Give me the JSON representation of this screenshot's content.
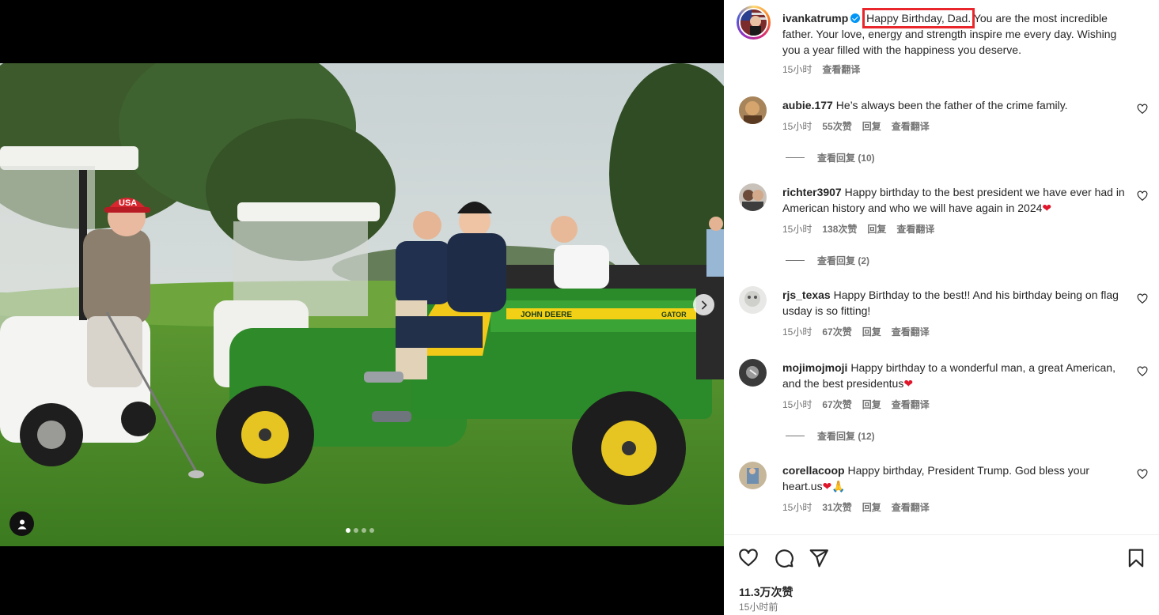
{
  "post": {
    "author": "ivankatrump",
    "caption_highlight": "Happy Birthday, Dad.",
    "caption_rest": " You are the most incredible father. Your love, energy and strength inspire me every day. Wishing you a year filled with the happiness you deserve.",
    "time": "15小时",
    "translate": "查看翻译"
  },
  "comments": [
    {
      "user": "aubie.177",
      "text": "He’s always been the father of the crime family.",
      "emoji": "",
      "time": "15小时",
      "likes": "55次赞",
      "reply": "回复",
      "translate": "查看翻译",
      "view_replies": "查看回复 (10)"
    },
    {
      "user": "richter3907",
      "text": "Happy birthday to the best president we have ever had in American history and who we will have again in 2024",
      "emoji": "❤",
      "time": "15小时",
      "likes": "138次赞",
      "reply": "回复",
      "translate": "查看翻译",
      "view_replies": "查看回复 (2)"
    },
    {
      "user": "rjs_texas",
      "text": "Happy Birthday to the best!! And his birthday being on flag usday is so fitting!",
      "emoji": "",
      "time": "15小时",
      "likes": "67次赞",
      "reply": "回复",
      "translate": "查看翻译",
      "view_replies": ""
    },
    {
      "user": "mojimojmoji",
      "text": "Happy birthday to a wonderful man, a great American, and the best presidentus",
      "emoji": "❤",
      "time": "15小时",
      "likes": "67次赞",
      "reply": "回复",
      "translate": "查看翻译",
      "view_replies": "查看回复 (12)"
    },
    {
      "user": "corellacoop",
      "text": "Happy birthday, President Trump. God bless your heart.us",
      "emoji": "❤🙏",
      "time": "15小时",
      "likes": "31次赞",
      "reply": "回复",
      "translate": "查看翻译",
      "view_replies": ""
    }
  ],
  "footer": {
    "likes": "11.3万次赞",
    "time_ago": "15小时前"
  },
  "photo": {
    "cap_text": "USA",
    "vehicle_brand": "JOHN DEERE",
    "vehicle_model": "GATOR"
  },
  "carousel": {
    "count": 4,
    "active": 1
  },
  "icons": {
    "like": "heart-icon",
    "comment": "comment-icon",
    "share": "send-icon",
    "save": "bookmark-icon",
    "next": "chevron-right-icon",
    "tags": "user-tag-icon"
  }
}
